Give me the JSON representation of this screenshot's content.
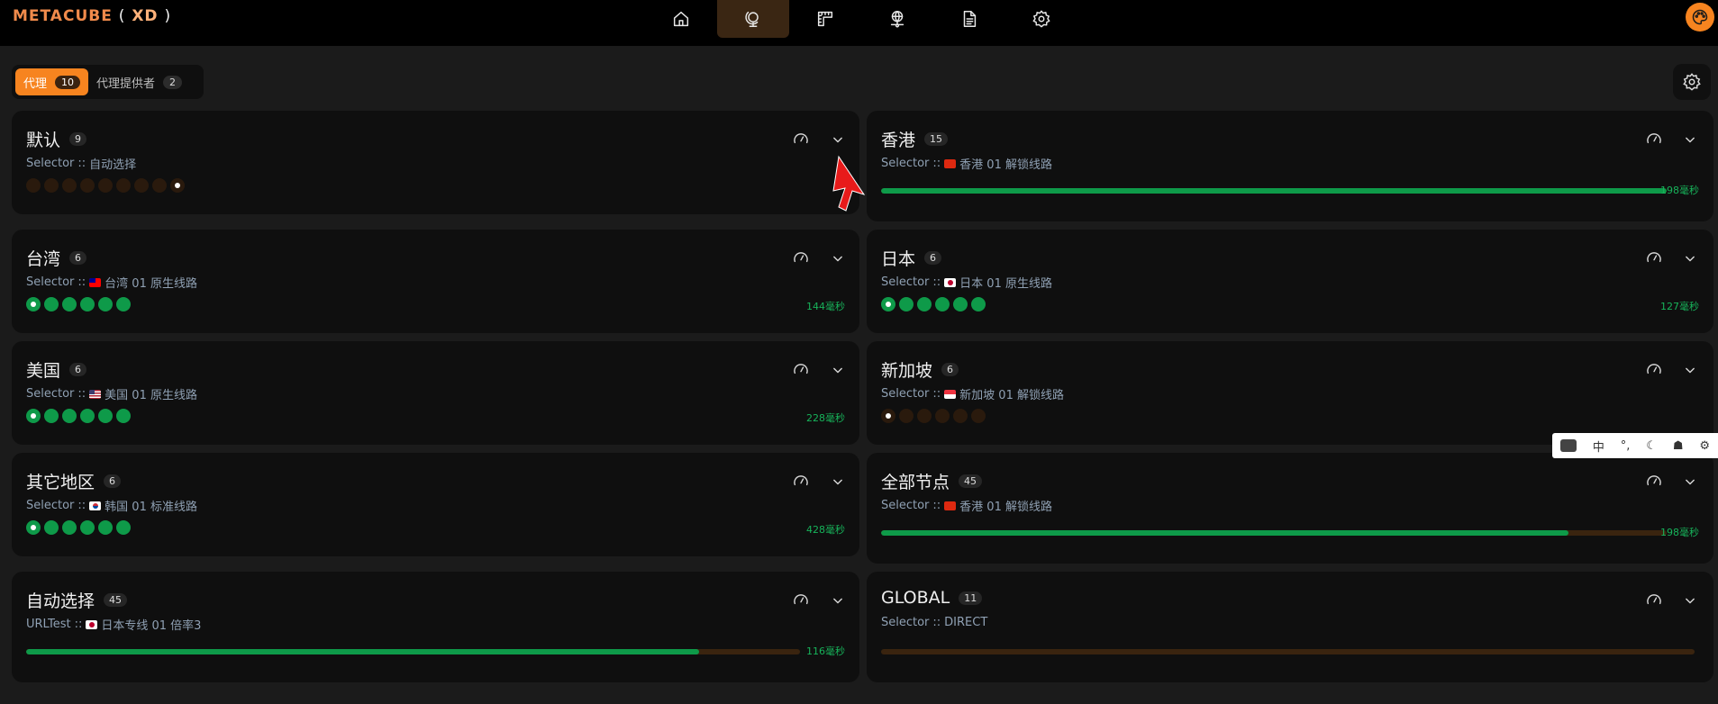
{
  "app": {
    "logo_main": "METACUBE",
    "logo_open": "(",
    "logo_xd": "XD",
    "logo_close": ")"
  },
  "nav": {
    "items": [
      "home-icon",
      "proxy-globe-icon",
      "rules-ruler-icon",
      "connections-globe-icon",
      "logs-document-icon",
      "settings-gear-icon"
    ],
    "active": 1
  },
  "tabs": [
    {
      "label": "代理",
      "count": "10"
    },
    {
      "label": "代理提供者",
      "count": "2"
    }
  ],
  "groups": {
    "g0": {
      "name": "默认",
      "count": "9",
      "type": "Selector",
      "sep": "::",
      "now": "自动选择",
      "flag": "",
      "latency": ""
    },
    "g1": {
      "name": "香港",
      "count": "15",
      "type": "Selector",
      "sep": "::",
      "now": "香港 01 解锁线路",
      "flag": "HK",
      "latency": "198毫秒"
    },
    "g2": {
      "name": "台湾",
      "count": "6",
      "type": "Selector",
      "sep": "::",
      "now": "台湾 01 原生线路",
      "flag": "TW",
      "latency": "144毫秒"
    },
    "g3": {
      "name": "日本",
      "count": "6",
      "type": "Selector",
      "sep": "::",
      "now": "日本 01 原生线路",
      "flag": "JP",
      "latency": "127毫秒"
    },
    "g4": {
      "name": "美国",
      "count": "6",
      "type": "Selector",
      "sep": "::",
      "now": "美国 01 原生线路",
      "flag": "US",
      "latency": "228毫秒"
    },
    "g5": {
      "name": "新加坡",
      "count": "6",
      "type": "Selector",
      "sep": "::",
      "now": "新加坡 01 解锁线路",
      "flag": "SG",
      "latency": ""
    },
    "g6": {
      "name": "其它地区",
      "count": "6",
      "type": "Selector",
      "sep": "::",
      "now": "韩国 01 标准线路",
      "flag": "KR",
      "latency": "428毫秒"
    },
    "g7": {
      "name": "全部节点",
      "count": "45",
      "type": "Selector",
      "sep": "::",
      "now": "香港 01 解锁线路",
      "flag": "HK",
      "latency": "198毫秒"
    },
    "g8": {
      "name": "自动选择",
      "count": "45",
      "type": "URLTest",
      "sep": "::",
      "now": "日本专线 01 倍率3",
      "flag": "JP",
      "latency": "116毫秒"
    },
    "g9": {
      "name": "GLOBAL",
      "count": "11",
      "type": "Selector",
      "sep": "::",
      "now": "DIRECT",
      "flag": "",
      "latency": ""
    }
  },
  "ime_toolbar": {
    "lang": "中",
    "punct": "°,"
  },
  "colors": {
    "accent": "#f7841f",
    "ok": "#0e9a49",
    "latency": "#17b35a",
    "idle": "#2a1a0d"
  }
}
